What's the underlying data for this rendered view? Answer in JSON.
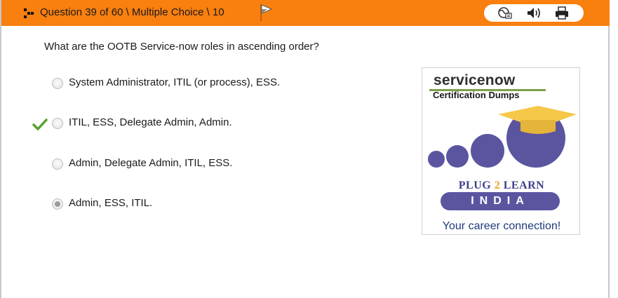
{
  "header": {
    "title": "Question 39 of 60 \\ Multiple Choice \\ 10",
    "background_color": "#f97f0f",
    "icons": {
      "move": "move-handle-icon",
      "flag": "flag-icon",
      "toolbar": [
        "globe-icon",
        "speaker-icon",
        "printer-icon"
      ]
    }
  },
  "question": {
    "text": "What are the OOTB Service-now roles in ascending order?"
  },
  "options": [
    {
      "label": "System Administrator, ITIL (or process), ESS.",
      "selected": false,
      "correct": false
    },
    {
      "label": "ITIL, ESS, Delegate Admin, Admin.",
      "selected": false,
      "correct": true
    },
    {
      "label": "Admin, Delegate Admin, ITIL, ESS.",
      "selected": false,
      "correct": false
    },
    {
      "label": "Admin, ESS, ITIL.",
      "selected": true,
      "correct": false
    }
  ],
  "ad": {
    "brand": "servicenow",
    "subtitle": "Certification Dumps",
    "plug_left": "PLUG ",
    "plug_mid": "2",
    "plug_right": " LEARN",
    "india": "INDIA",
    "tagline": "Your career connection!",
    "colors": {
      "purple": "#5b55a0",
      "cap": "#f5c84a",
      "brand_green": "#7aa14a"
    }
  }
}
